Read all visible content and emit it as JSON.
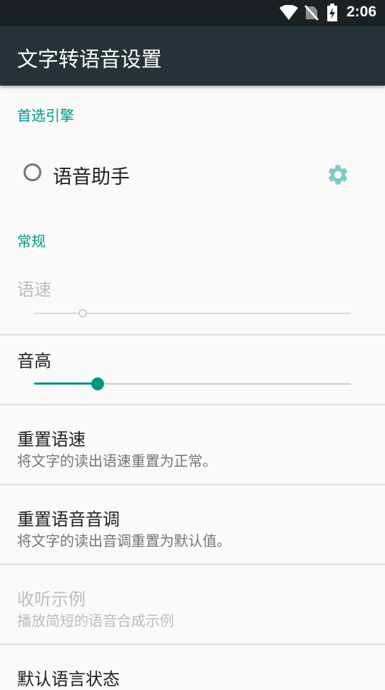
{
  "status_bar": {
    "time": "2:06",
    "icons": [
      "wifi-icon",
      "no-sim-icon",
      "battery-charging-icon"
    ]
  },
  "app_bar": {
    "title": "文字转语音设置"
  },
  "sections": {
    "engine": {
      "header": "首选引擎",
      "engine_name": "语音助手",
      "selected": false
    },
    "general": {
      "header": "常规",
      "speech_rate": {
        "label": "语速",
        "value": 0.15,
        "enabled": false
      },
      "pitch": {
        "label": "音高",
        "value": 0.2,
        "enabled": true
      },
      "reset_rate": {
        "title": "重置语速",
        "summary": "将文字的读出语速重置为正常。"
      },
      "reset_pitch": {
        "title": "重置语音音调",
        "summary": "将文字的读出音调重置为默认值。"
      },
      "listen_example": {
        "title": "收听示例",
        "summary": "播放简短的语音合成示例",
        "enabled": false
      },
      "default_language_status": {
        "title": "默认语言状态"
      }
    }
  },
  "colors": {
    "accent": "#009688",
    "app_bar": "#263238",
    "status_bar": "#1b2023",
    "background": "#fafafa",
    "disabled_text": "#bdbdbd"
  }
}
